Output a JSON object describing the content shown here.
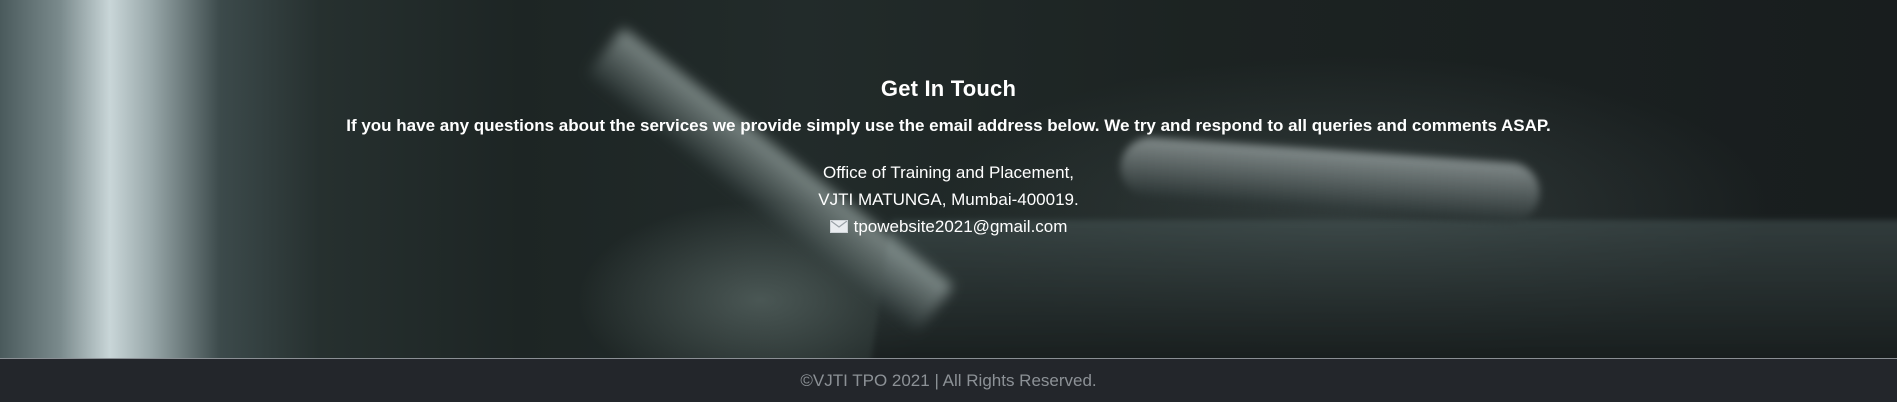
{
  "contact": {
    "heading": "Get In Touch",
    "subtitle": "If you have any questions about the services we provide simply use the email address below. We try and respond to all queries and comments ASAP.",
    "address_line1": "Office of Training and Placement,",
    "address_line2": "VJTI MATUNGA, Mumbai-400019.",
    "email": "tpowebsite2021@gmail.com",
    "email_icon": "envelope-icon"
  },
  "footer": {
    "copyright": "©VJTI TPO 2021 | All Rights Reserved."
  },
  "colors": {
    "footer_background": "#23262b",
    "footer_text": "#8c9196",
    "contact_text": "#ffffff"
  }
}
